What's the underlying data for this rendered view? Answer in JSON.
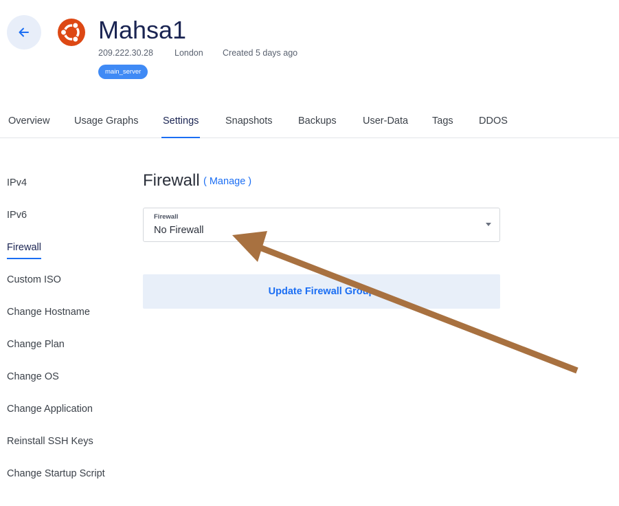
{
  "header": {
    "server_name": "Mahsa1",
    "ip": "209.222.30.28",
    "location": "London",
    "created": "Created 5 days ago",
    "tag": "main_server",
    "back_icon": "arrow-left-icon",
    "os_icon": "ubuntu-logo-icon"
  },
  "tabs": [
    {
      "label": "Overview"
    },
    {
      "label": "Usage Graphs"
    },
    {
      "label": "Settings",
      "active": true
    },
    {
      "label": "Snapshots"
    },
    {
      "label": "Backups"
    },
    {
      "label": "User-Data"
    },
    {
      "label": "Tags"
    },
    {
      "label": "DDOS"
    }
  ],
  "sidebar": {
    "items": [
      {
        "label": "IPv4"
      },
      {
        "label": "IPv6"
      },
      {
        "label": "Firewall",
        "active": true
      },
      {
        "label": "Custom ISO"
      },
      {
        "label": "Change Hostname"
      },
      {
        "label": "Change Plan"
      },
      {
        "label": "Change OS"
      },
      {
        "label": "Change Application"
      },
      {
        "label": "Reinstall SSH Keys"
      },
      {
        "label": "Change Startup Script"
      }
    ]
  },
  "firewall": {
    "title": "Firewall",
    "manage_link": "( Manage )",
    "select_label": "Firewall",
    "select_value": "No Firewall",
    "update_button": "Update Firewall Group"
  },
  "colors": {
    "accent": "#1b6ef3",
    "badge": "#3f8af5",
    "ubuntu_orange": "#dd4814",
    "annotation_arrow": "#a87140"
  }
}
